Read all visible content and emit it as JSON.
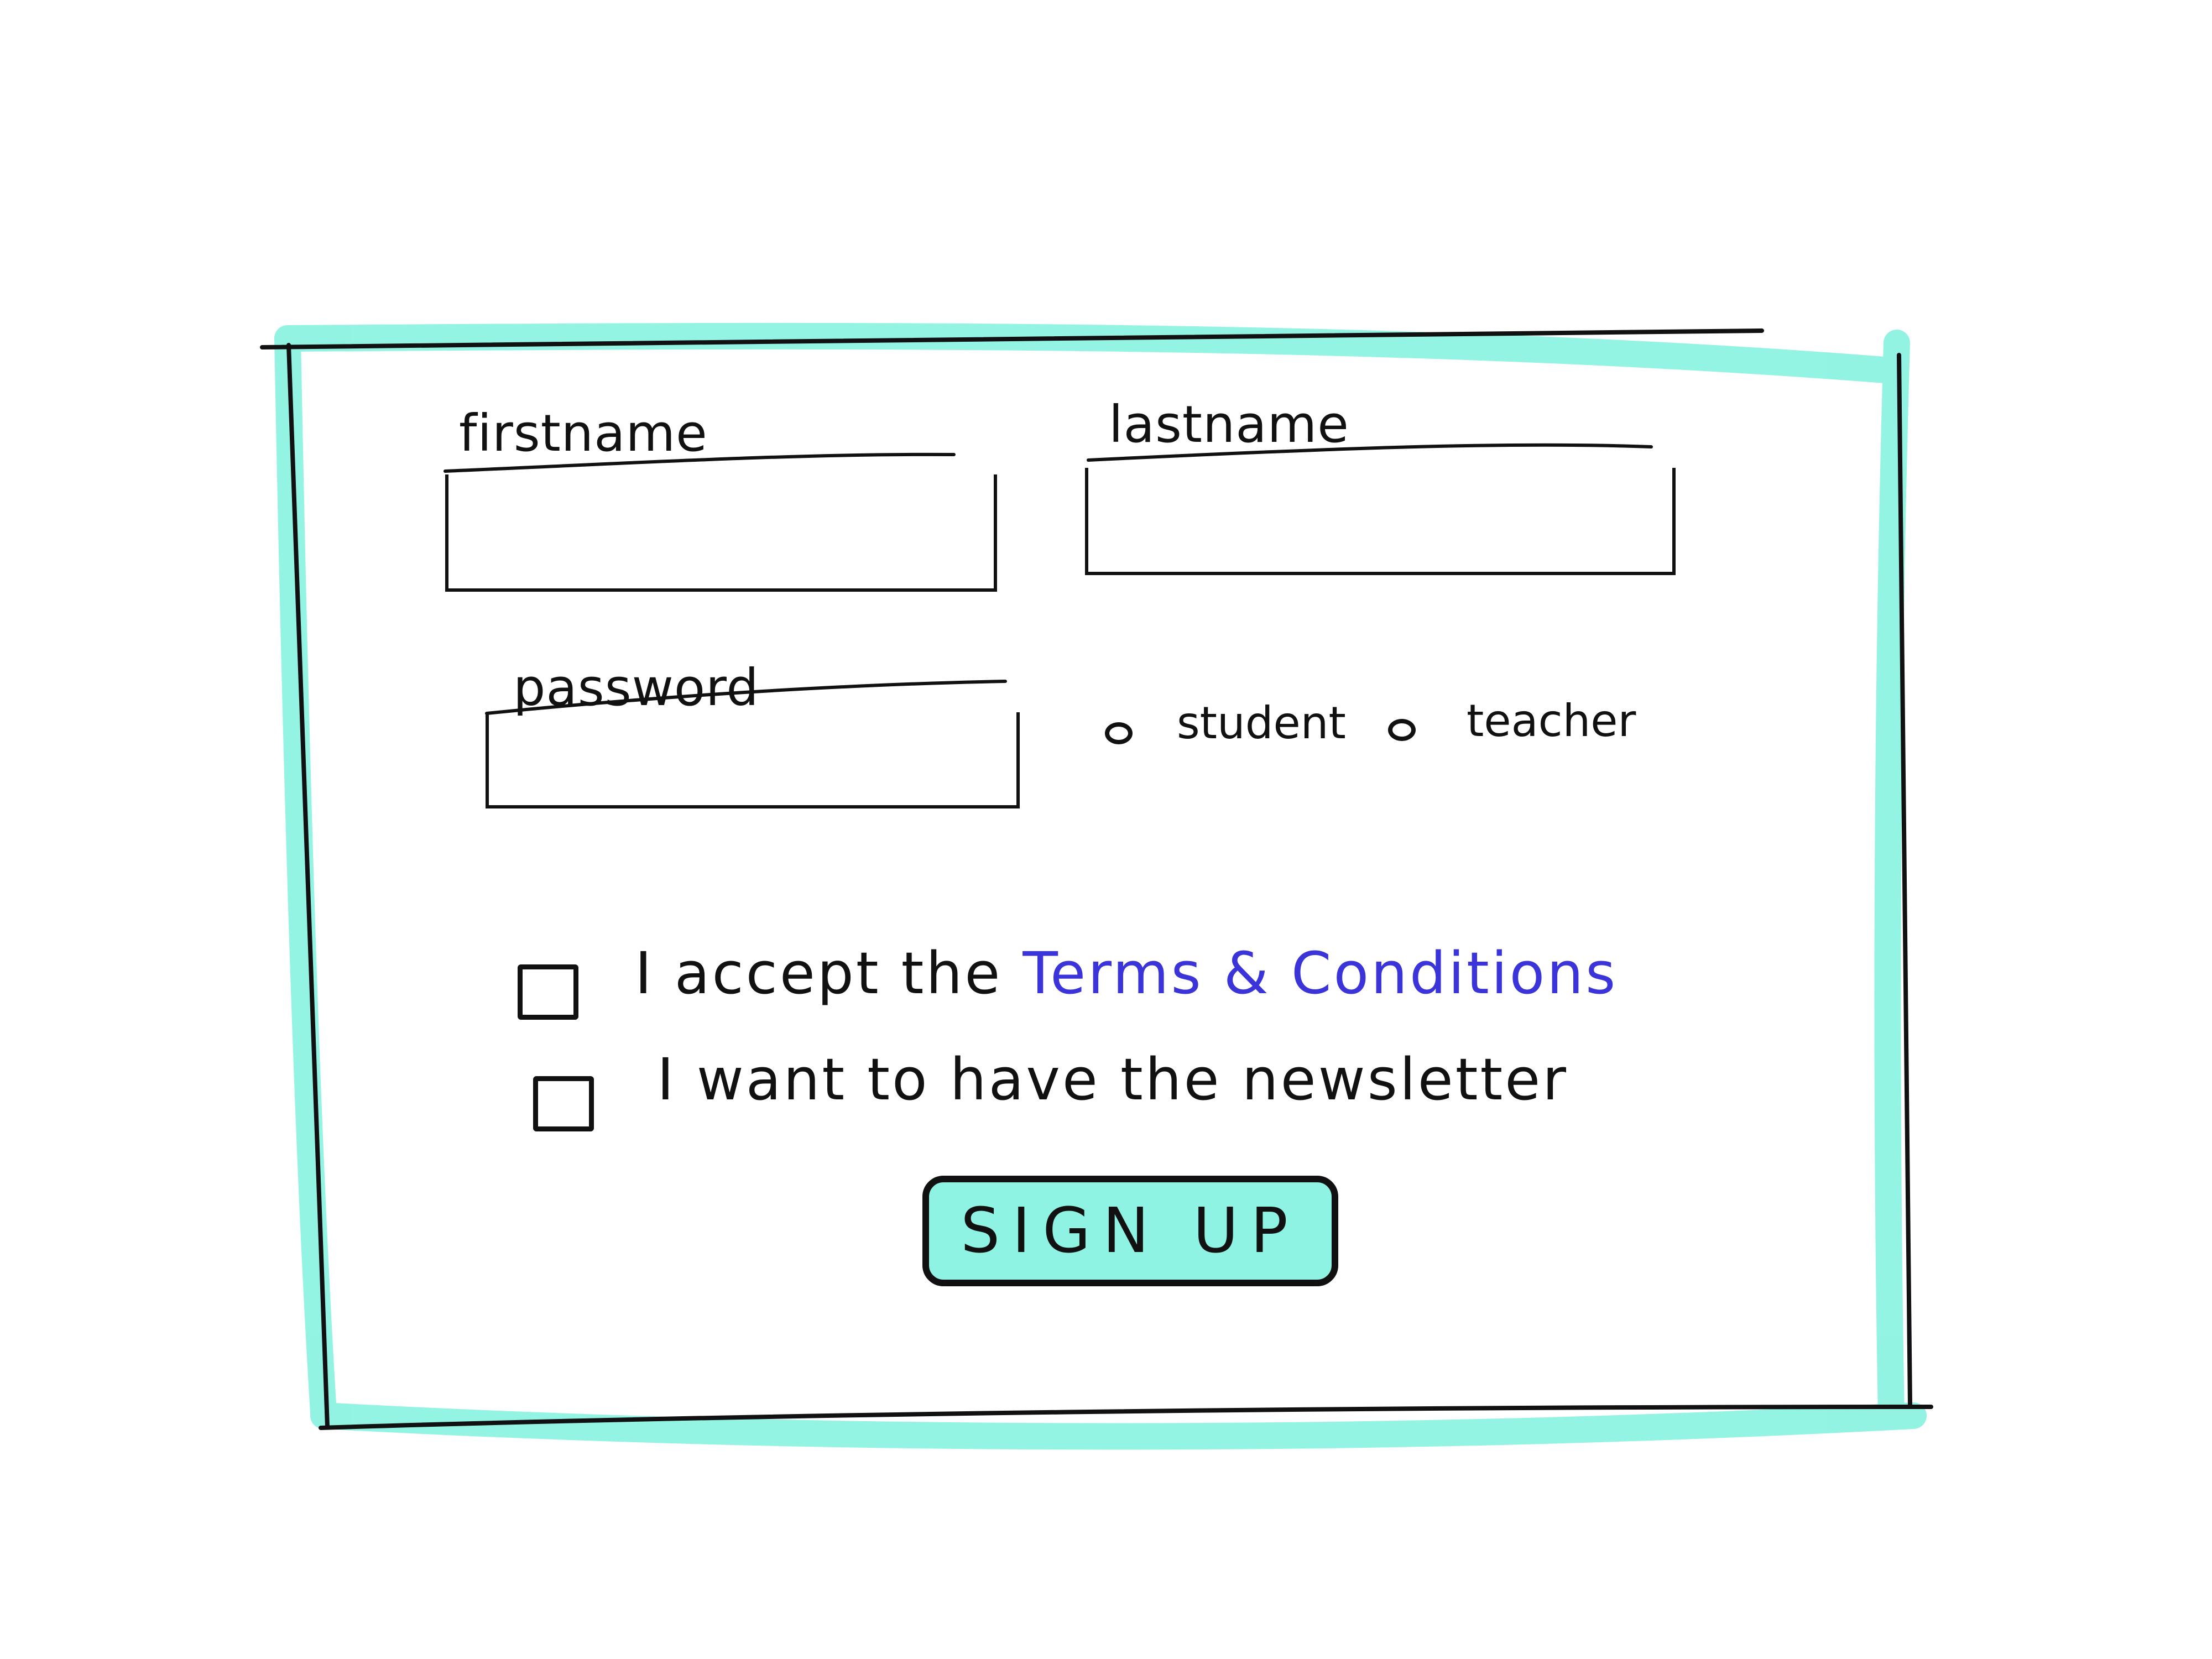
{
  "colors": {
    "accent": "#8ef3e2",
    "ink": "#111111",
    "link": "#3b34d9"
  },
  "form": {
    "firstname_label": "firstname",
    "lastname_label": "lastname",
    "password_label": "password",
    "role_options": [
      "student",
      "teacher"
    ],
    "terms_prefix": "I accept the",
    "terms_link": "Terms & Conditions",
    "newsletter_label": "I want to have the newsletter",
    "submit_label": "SIGN UP"
  }
}
